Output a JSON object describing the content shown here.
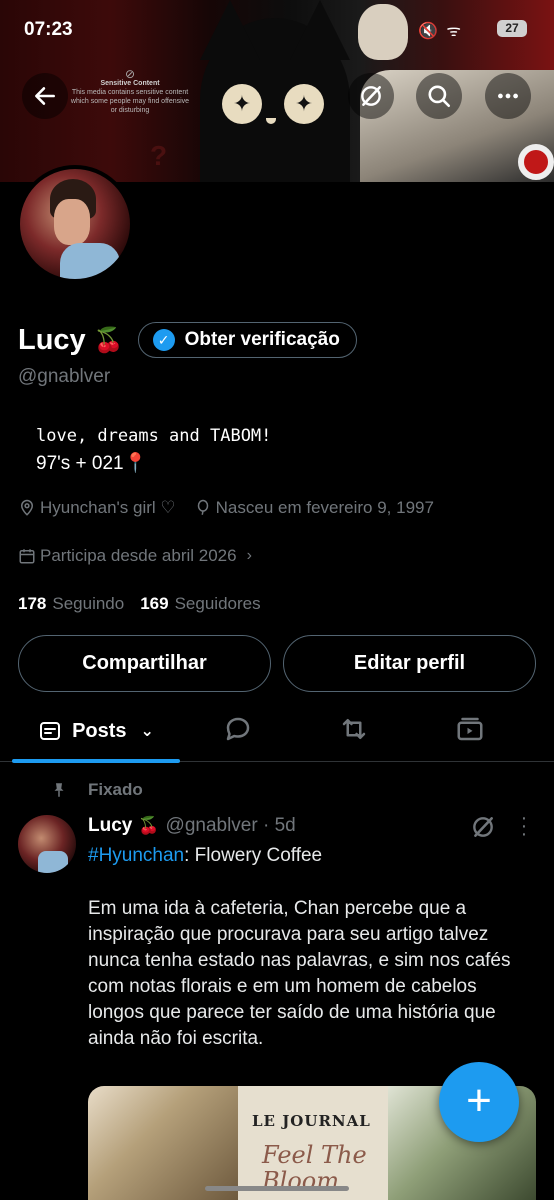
{
  "status_bar": {
    "time": "07:23",
    "battery": "27",
    "icons": "🔇 ᯤ"
  },
  "banner": {
    "sensitive_title": "Sensitive Content",
    "sensitive_text": "This media contains sensitive content which some people may find offensive or disturbing"
  },
  "profile": {
    "name": "Lucy",
    "emoji": "🍒",
    "verify_label": "Obter verificação",
    "handle": "@gnablver",
    "bio_line1": "love, dreams and TABOM!",
    "bio_line2": "97's + 021📍",
    "location": "Hyunchan's girl ♡",
    "birth": "Nasceu em fevereiro 9, 1997",
    "joined": "Participa desde abril 2026",
    "following_count": "178",
    "following_label": "Seguindo",
    "followers_count": "169",
    "followers_label": "Seguidores",
    "share_label": "Compartilhar",
    "edit_label": "Editar perfil"
  },
  "tabs": {
    "posts_label": "Posts"
  },
  "pinned_post": {
    "pinned_label": "Fixado",
    "author": "Lucy",
    "emoji": "🍒",
    "handle_time": "@gnablver · 5d",
    "hashtag": "#Hyunchan",
    "title_rest": ": Flowery Coffee",
    "body": "Em uma ida à cafeteria, Chan percebe que a inspiração que procurava para seu artigo talvez nunca tenha estado nas palavras, e sim nos cafés com notas florais e em um homem de cabelos longos que parece ter saído de uma história que ainda não foi escrita.",
    "media_header": "LE JOURNAL",
    "media_title": "Feel The Bloom"
  },
  "fab_icon": "plus-icon",
  "colors": {
    "accent": "#1d9bf0",
    "muted": "#71767b",
    "border": "#536471"
  }
}
